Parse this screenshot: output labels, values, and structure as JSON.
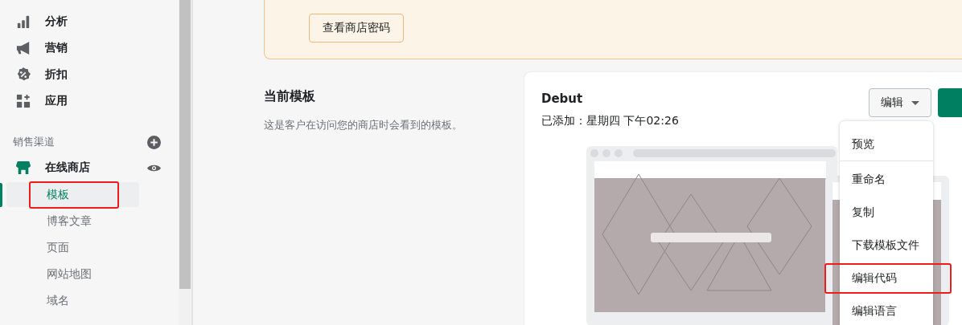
{
  "sidebar": {
    "nav": [
      {
        "label": "分析"
      },
      {
        "label": "营销"
      },
      {
        "label": "折扣"
      },
      {
        "label": "应用"
      }
    ],
    "channels_heading": "销售渠道",
    "channel": {
      "label": "在线商店"
    },
    "subitems": [
      {
        "label": "模板",
        "selected": true,
        "highlighted": true
      },
      {
        "label": "博客文章",
        "selected": false,
        "highlighted": false
      },
      {
        "label": "页面",
        "selected": false,
        "highlighted": false
      },
      {
        "label": "网站地图",
        "selected": false,
        "highlighted": false
      },
      {
        "label": "域名",
        "selected": false,
        "highlighted": false
      }
    ]
  },
  "banner": {
    "button": "查看商店密码"
  },
  "theme_section": {
    "title": "当前模板",
    "description": "这是客户在访问您的商店时会看到的模板。"
  },
  "theme_card": {
    "name": "Debut",
    "added": "已添加：星期四 下午02:26",
    "edit_button": "编辑",
    "menu": [
      {
        "label": "预览",
        "highlighted": false
      },
      {
        "label": "重命名",
        "highlighted": false
      },
      {
        "label": "复制",
        "highlighted": false
      },
      {
        "label": "下载模板文件",
        "highlighted": false
      },
      {
        "label": "编辑代码",
        "highlighted": true
      },
      {
        "label": "编辑语言",
        "highlighted": false
      }
    ]
  }
}
